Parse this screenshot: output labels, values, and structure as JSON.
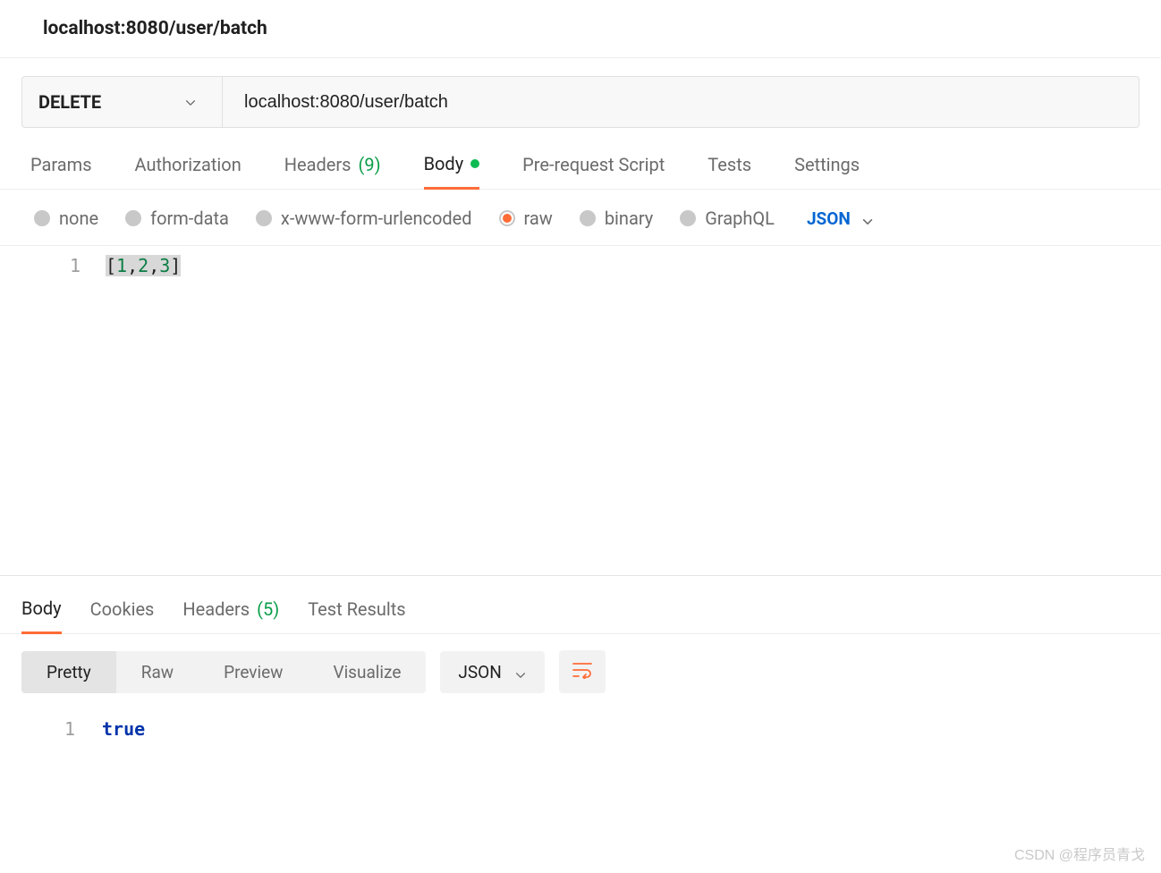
{
  "tabTitle": "localhost:8080/user/batch",
  "request": {
    "method": "DELETE",
    "url": "localhost:8080/user/batch"
  },
  "requestTabs": {
    "params": "Params",
    "auth": "Authorization",
    "headers": "Headers",
    "headersCount": "(9)",
    "body": "Body",
    "prerequest": "Pre-request Script",
    "tests": "Tests",
    "settings": "Settings"
  },
  "bodyTypes": {
    "none": "none",
    "formdata": "form-data",
    "urlencoded": "x-www-form-urlencoded",
    "raw": "raw",
    "binary": "binary",
    "graphql": "GraphQL",
    "lang": "JSON"
  },
  "requestBody": {
    "line1": "1",
    "content_open": "[",
    "content_v1": "1",
    "content_c1": ",",
    "content_v2": "2",
    "content_c2": ",",
    "content_v3": "3",
    "content_close": "]"
  },
  "responseTabs": {
    "body": "Body",
    "cookies": "Cookies",
    "headers": "Headers",
    "headersCount": "(5)",
    "testResults": "Test Results"
  },
  "responseView": {
    "pretty": "Pretty",
    "raw": "Raw",
    "preview": "Preview",
    "visualize": "Visualize",
    "format": "JSON"
  },
  "responseBody": {
    "line1": "1",
    "value": "true"
  },
  "watermark": "CSDN @程序员青戈"
}
